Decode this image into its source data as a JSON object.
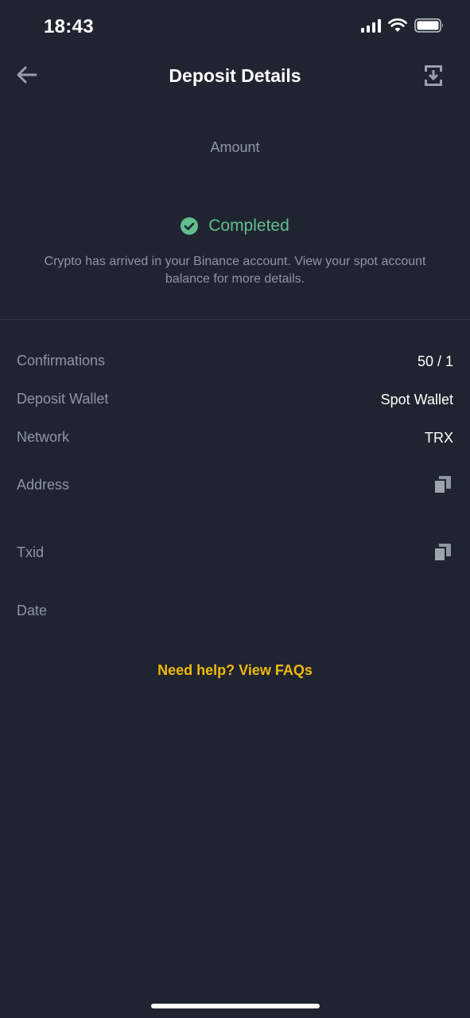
{
  "status_bar": {
    "time": "18:43"
  },
  "header": {
    "title": "Deposit Details"
  },
  "amount": {
    "label": "Amount"
  },
  "deposit_status": {
    "text": "Completed",
    "description": "Crypto has arrived in your Binance account. View your spot account balance for more details."
  },
  "details": {
    "confirmations": {
      "label": "Confirmations",
      "value": "50 / 1"
    },
    "deposit_wallet": {
      "label": "Deposit Wallet",
      "value": "Spot Wallet"
    },
    "network": {
      "label": "Network",
      "value": "TRX"
    },
    "address": {
      "label": "Address"
    },
    "txid": {
      "label": "Txid"
    },
    "date": {
      "label": "Date"
    }
  },
  "help": {
    "link_text": "Need help? View FAQs"
  },
  "colors": {
    "background": "#1f2430",
    "success": "#5fbf8d",
    "accent": "#f0b90b",
    "muted_text": "#8f96a3"
  },
  "icons": [
    "back-arrow-icon",
    "share-icon",
    "check-circle-icon",
    "copy-icon",
    "signal-icon",
    "wifi-icon",
    "battery-icon"
  ]
}
